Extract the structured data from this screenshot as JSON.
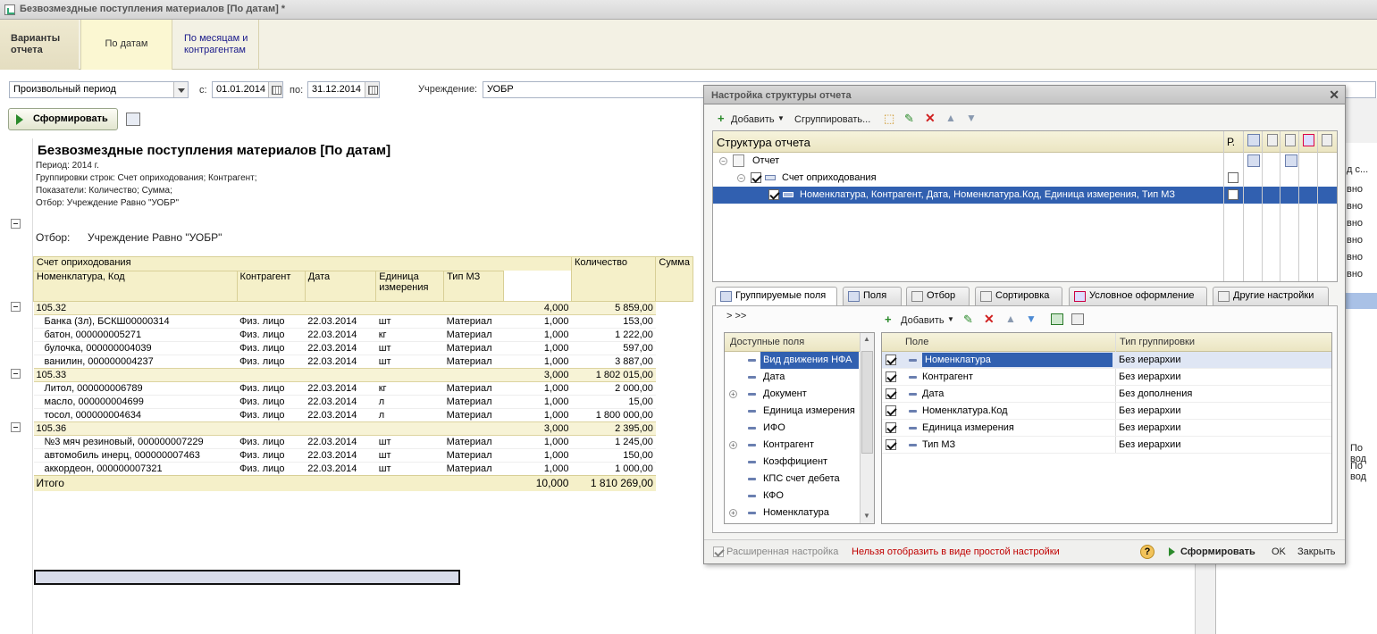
{
  "window": {
    "title": "Безвозмездные поступления материалов [По датам] *"
  },
  "variants": {
    "tab1": "Варианты отчета",
    "tab2": "По датам",
    "tab3": "По месяцам и контрагентам"
  },
  "period": {
    "type": "Произвольный период",
    "from_label": "с:",
    "from": "01.01.2014",
    "to_label": "по:",
    "to": "31.12.2014",
    "org_label": "Учреждение:",
    "org": "УОБР"
  },
  "run_button": "Сформировать",
  "report": {
    "title": "Безвозмездные поступления материалов [По датам]",
    "info": [
      "Период: 2014 г.",
      "Группировки строк: Счет оприходования; Контрагент;",
      "Показатели: Количество; Сумма;",
      "Отбор: Учреждение Равно \"УОБР\""
    ],
    "filter_label": "Отбор:",
    "filter_value": "Учреждение Равно \"УОБР\"",
    "headers": {
      "account": "Счет оприходования",
      "nomen": "Номенклатура, Код",
      "contr": "Контрагент",
      "date": "Дата",
      "unit": "Единица измерения",
      "type": "Тип МЗ",
      "qty": "Количество",
      "sum": "Сумма"
    },
    "groups": [
      {
        "name": "105.32",
        "qty": "4,000",
        "sum": "5 859,00",
        "rows": [
          [
            "Банка (3л), БСКШ00000314",
            "Физ. лицо",
            "22.03.2014",
            "шт",
            "Материал",
            "1,000",
            "153,00"
          ],
          [
            "батон, 000000005271",
            "Физ. лицо",
            "22.03.2014",
            "кг",
            "Материал",
            "1,000",
            "1 222,00"
          ],
          [
            "булочка, 000000004039",
            "Физ. лицо",
            "22.03.2014",
            "шт",
            "Материал",
            "1,000",
            "597,00"
          ],
          [
            "ванилин, 000000004237",
            "Физ. лицо",
            "22.03.2014",
            "шт",
            "Материал",
            "1,000",
            "3 887,00"
          ]
        ]
      },
      {
        "name": "105.33",
        "qty": "3,000",
        "sum": "1 802 015,00",
        "rows": [
          [
            "Литол, 000000006789",
            "Физ. лицо",
            "22.03.2014",
            "кг",
            "Материал",
            "1,000",
            "2 000,00"
          ],
          [
            "масло, 000000004699",
            "Физ. лицо",
            "22.03.2014",
            "л",
            "Материал",
            "1,000",
            "15,00"
          ],
          [
            "тосол, 000000004634",
            "Физ. лицо",
            "22.03.2014",
            "л",
            "Материал",
            "1,000",
            "1 800 000,00"
          ]
        ]
      },
      {
        "name": "105.36",
        "qty": "3,000",
        "sum": "2 395,00",
        "rows": [
          [
            "№3 мяч резиновый, 000000007229",
            "Физ. лицо",
            "22.03.2014",
            "шт",
            "Материал",
            "1,000",
            "1 245,00"
          ],
          [
            "автомобиль инерц, 000000007463",
            "Физ. лицо",
            "22.03.2014",
            "шт",
            "Материал",
            "1,000",
            "150,00"
          ],
          [
            "аккордеон, 000000007321",
            "Физ. лицо",
            "22.03.2014",
            "шт",
            "Материал",
            "1,000",
            "1 000,00"
          ]
        ]
      }
    ],
    "total_label": "Итого",
    "total_qty": "10,000",
    "total_sum": "1 810 269,00"
  },
  "bg": {
    "cells": [
      "вно",
      "вно",
      "вно",
      "вно",
      "вно",
      "вно",
      "По вод",
      "По вод"
    ],
    "head": "д с..."
  },
  "dialog": {
    "title": "Настройка структуры отчета",
    "toolbar": {
      "add": "Добавить",
      "group": "Сгруппировать..."
    },
    "structure_header": "Структура отчета",
    "col_r": "Р.",
    "tree": [
      "Отчет",
      "Счет оприходования",
      "Номенклатура, Контрагент, Дата, Номенклатура.Код, Единица измерения, Тип МЗ"
    ],
    "tabs": [
      "Группируемые поля",
      "Поля",
      "Отбор",
      "Сортировка",
      "Условное оформление",
      "Другие настройки"
    ],
    "nav": ">  >>",
    "avail_header": "Доступные поля",
    "avail": [
      "Вид движения НФА",
      "Дата",
      "Документ",
      "Единица измерения",
      "ИФО",
      "Контрагент",
      "Коэффициент",
      "КПС счет дебета",
      "КФО",
      "Номенклатура"
    ],
    "fields_toolbar": {
      "add": "Добавить"
    },
    "fields_header": {
      "field": "Поле",
      "gtype": "Тип группировки"
    },
    "fields": [
      [
        "Номенклатура",
        "Без иерархии"
      ],
      [
        "Контрагент",
        "Без иерархии"
      ],
      [
        "Дата",
        "Без дополнения"
      ],
      [
        "Номенклатура.Код",
        "Без иерархии"
      ],
      [
        "Единица измерения",
        "Без иерархии"
      ],
      [
        "Тип МЗ",
        "Без иерархии"
      ]
    ],
    "footer": {
      "ext": "Расширенная настройка",
      "warn": "Нельзя отобразить в виде простой настройки",
      "run": "Сформировать",
      "ok": "OK",
      "close": "Закрыть",
      "help": "?"
    }
  }
}
